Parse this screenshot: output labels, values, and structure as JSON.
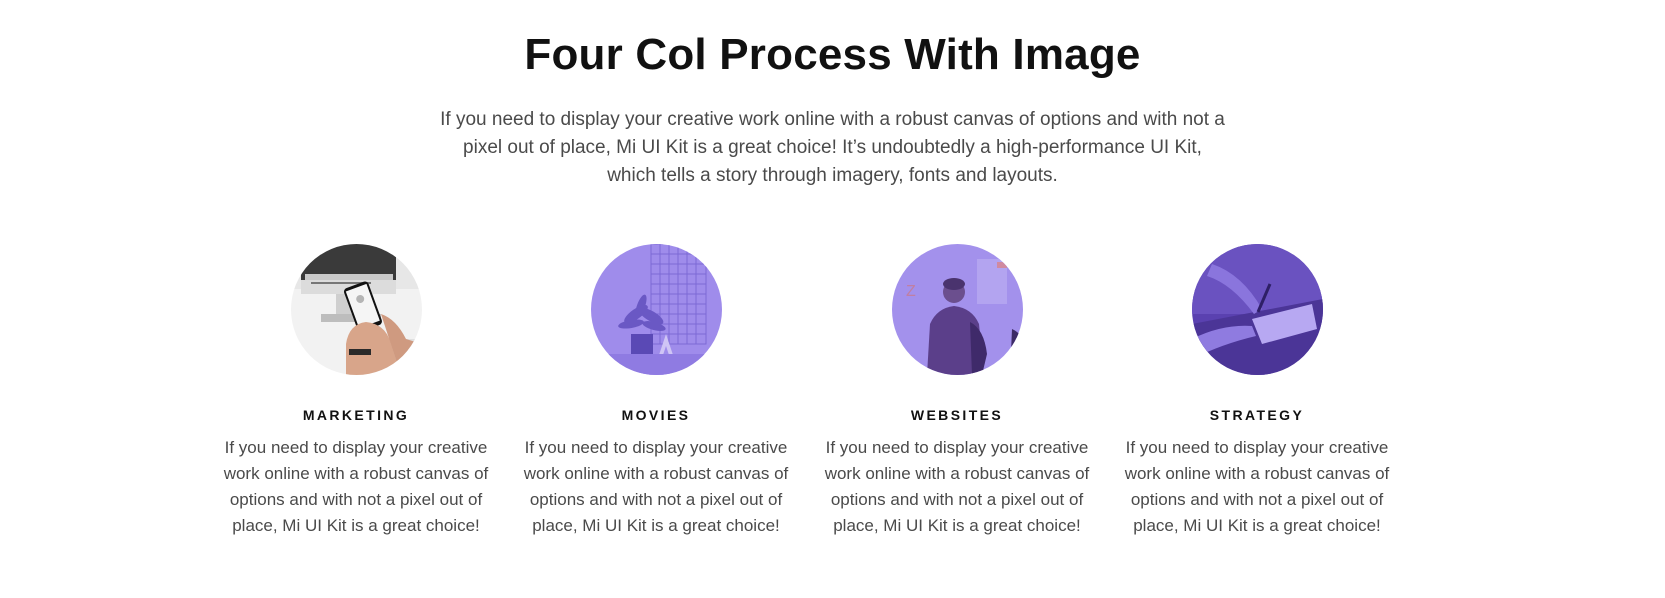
{
  "section": {
    "title": "Four Col Process With Image",
    "lead": "If you need to display your creative work online with a robust canvas of options and with not a pixel out of place, Mi UI Kit is a great choice! It’s undoubtedly a high-performance UI Kit, which tells a story through imagery, fonts and layouts."
  },
  "colors": {
    "accent": "#9b87ea",
    "accent_dark": "#4f37a3",
    "text": "#4a4a4a",
    "heading": "#111111"
  },
  "items": [
    {
      "title": "MARKETING",
      "text": "If you need to display your creative work online with a robust canvas of options and with not a pixel out of place, Mi UI Kit is a great choice!",
      "image": "hand-holding-phone-at-desk"
    },
    {
      "title": "MOVIES",
      "text": "If you need to display your creative work online with a robust canvas of options and with not a pixel out of place, Mi UI Kit is a great choice!",
      "image": "plant-and-grid-shelf"
    },
    {
      "title": "WEBSITES",
      "text": "If you need to display your creative work online with a robust canvas of options and with not a pixel out of place, Mi UI Kit is a great choice!",
      "image": "man-in-front-of-board"
    },
    {
      "title": "STRATEGY",
      "text": "If you need to display your creative work online with a robust canvas of options and with not a pixel out of place, Mi UI Kit is a great choice!",
      "image": "hands-writing-on-paper"
    }
  ]
}
